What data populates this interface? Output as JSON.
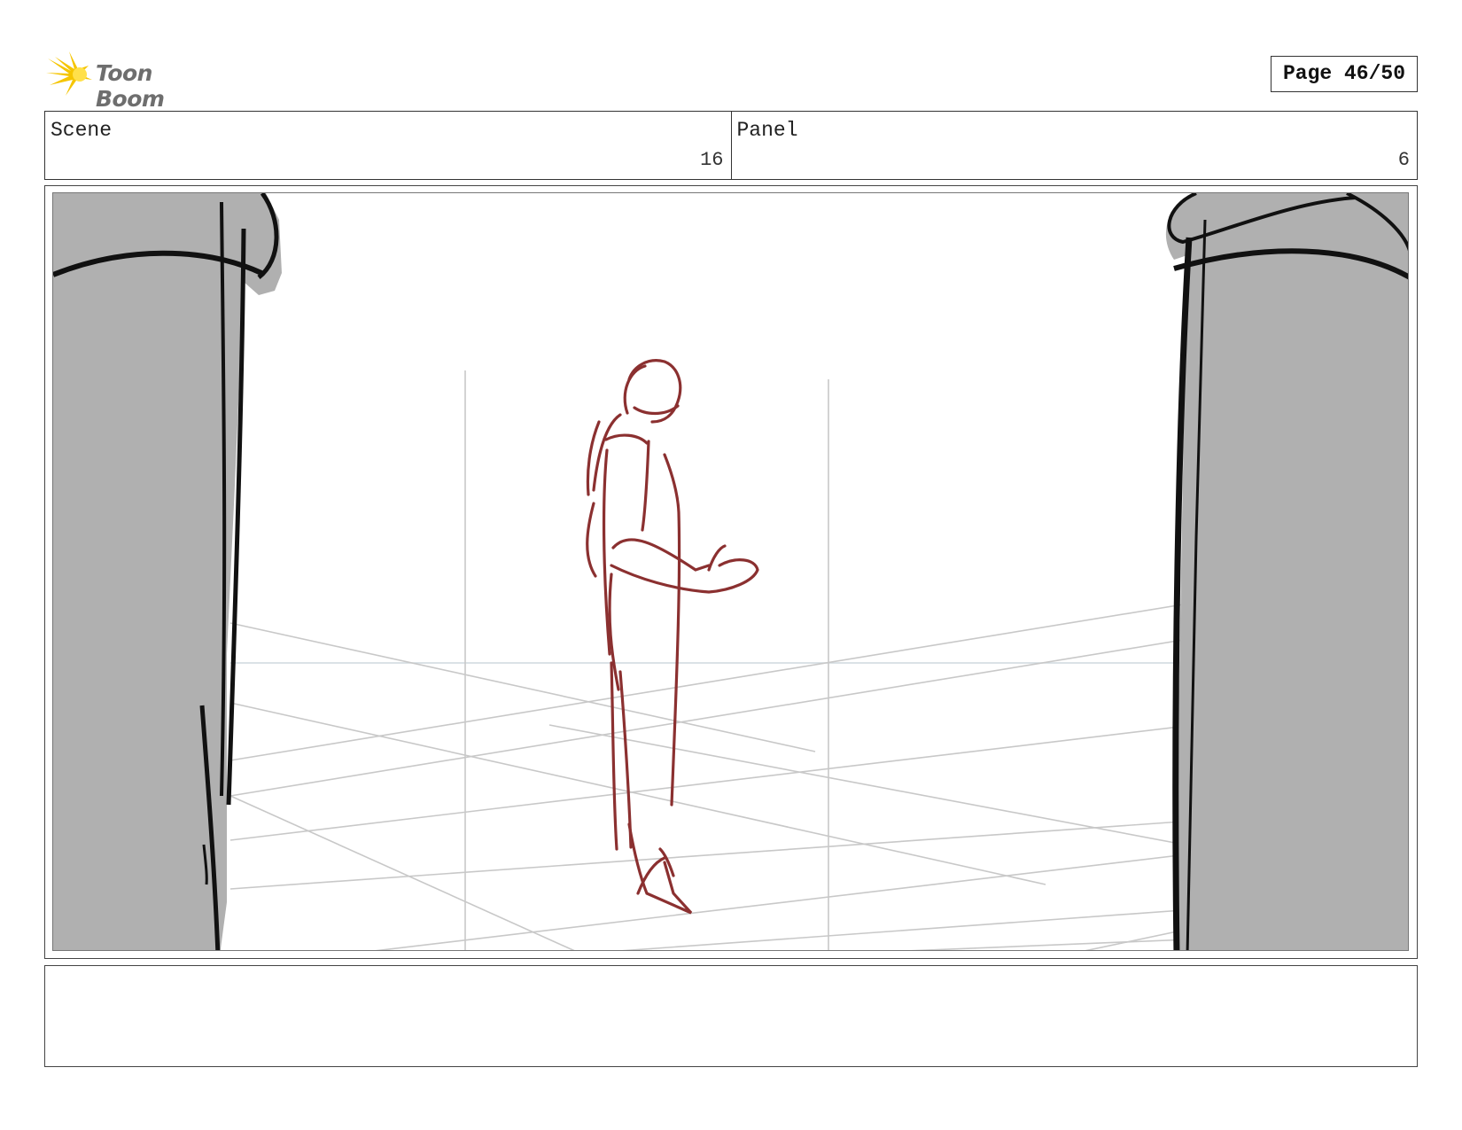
{
  "header": {
    "brand": "Toon Boom",
    "page_label": "Page 46/50"
  },
  "scene": {
    "label": "Scene",
    "value": "16"
  },
  "panel": {
    "label": "Panel",
    "value": "6"
  },
  "colors": {
    "logo_yellow": "#f5c500",
    "pillar_gray": "#b0b0b0",
    "figure_red": "#8b3030",
    "grid_gray": "#c8c8c8"
  },
  "notes": ""
}
